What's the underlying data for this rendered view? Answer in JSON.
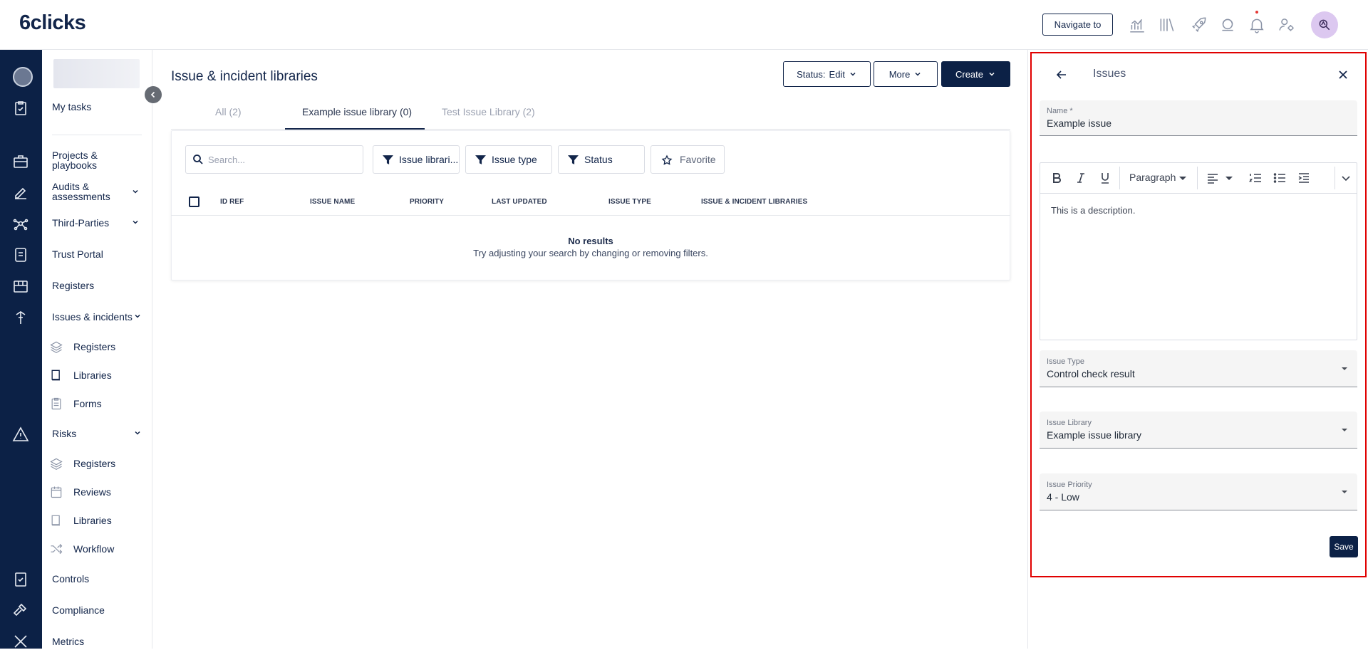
{
  "brand": {
    "logo": "6clicks"
  },
  "topbar": {
    "navigate_to": "Navigate to",
    "icons": [
      "analytics-icon",
      "library-icon",
      "rocket-icon",
      "support-icon",
      "bell-icon",
      "user-settings-icon",
      "avatar-icon"
    ]
  },
  "sidebar": {
    "my_tasks": "My tasks",
    "items": [
      {
        "label": "Projects & playbooks"
      },
      {
        "label": "Audits & assessments"
      },
      {
        "label": "Third-Parties"
      },
      {
        "label": "Trust Portal"
      },
      {
        "label": "Registers"
      },
      {
        "label": "Issues & incidents"
      },
      {
        "label": "Registers"
      },
      {
        "label": "Libraries"
      },
      {
        "label": "Forms"
      },
      {
        "label": "Risks"
      },
      {
        "label": "Registers"
      },
      {
        "label": "Reviews"
      },
      {
        "label": "Libraries"
      },
      {
        "label": "Workflow"
      },
      {
        "label": "Controls"
      },
      {
        "label": "Compliance"
      },
      {
        "label": "Metrics"
      }
    ]
  },
  "main": {
    "title": "Issue & incident libraries",
    "status_prefix": "Status:",
    "status_value": "Edit",
    "more": "More",
    "create": "Create",
    "tabs": [
      {
        "label": "All (2)"
      },
      {
        "label": "Example issue library (0)"
      },
      {
        "label": "Test Issue Library (2)"
      }
    ],
    "search_placeholder": "Search...",
    "filters": [
      "Issue librari...",
      "Issue type",
      "Status"
    ],
    "favorite": "Favorite",
    "columns": [
      "ID REF",
      "ISSUE NAME",
      "PRIORITY",
      "LAST UPDATED",
      "ISSUE TYPE",
      "ISSUE & INCIDENT LIBRARIES"
    ],
    "empty_title": "No results",
    "empty_sub": "Try adjusting your search by changing or removing filters."
  },
  "panel": {
    "title": "Issues",
    "name_label": "Name *",
    "name_value": "Example issue",
    "toolbar": {
      "paragraph": "Paragraph"
    },
    "description": "This is a description.",
    "issue_type_label": "Issue Type",
    "issue_type_value": "Control check result",
    "issue_library_label": "Issue Library",
    "issue_library_value": "Example issue library",
    "issue_priority_label": "Issue Priority",
    "issue_priority_value": "4 - Low",
    "save": "Save"
  }
}
